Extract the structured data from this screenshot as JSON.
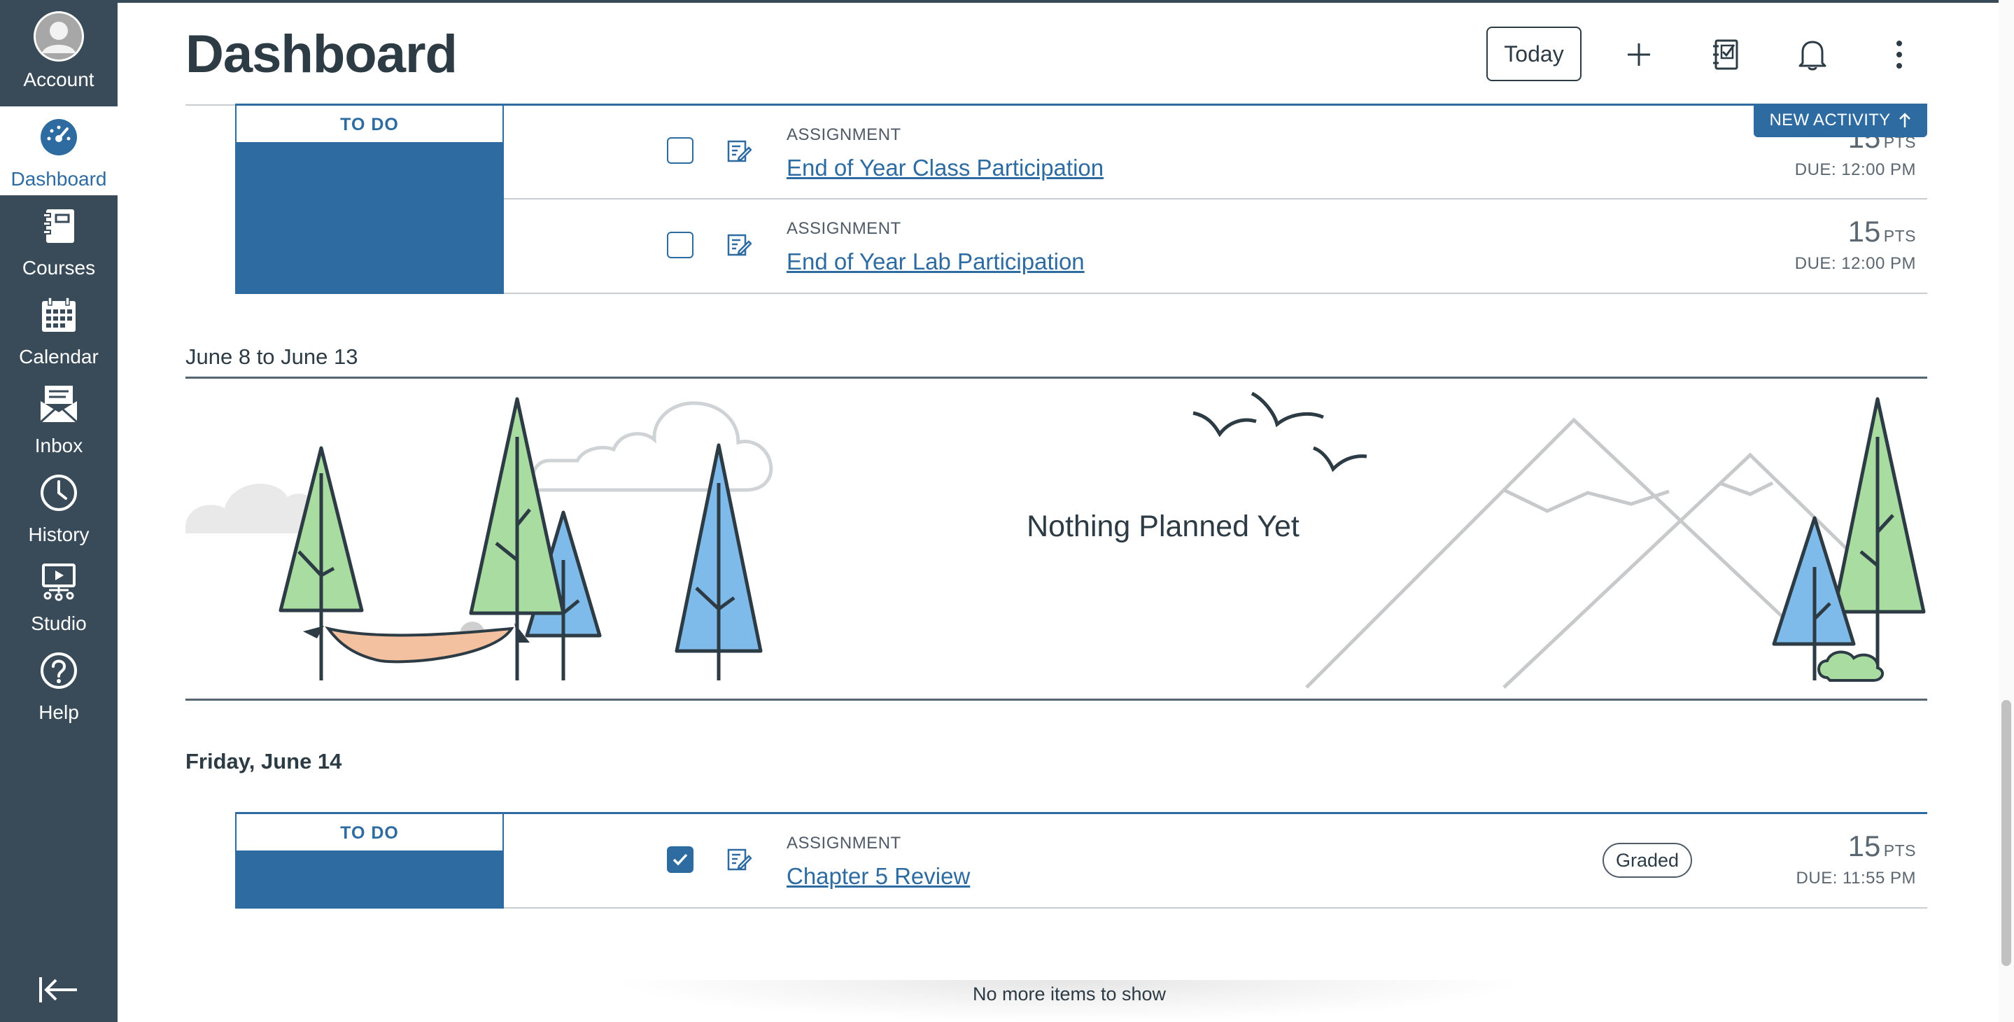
{
  "nav": {
    "items": [
      {
        "label": "Account",
        "icon": "account-avatar-icon"
      },
      {
        "label": "Dashboard",
        "icon": "dashboard-gauge-icon"
      },
      {
        "label": "Courses",
        "icon": "courses-book-icon"
      },
      {
        "label": "Calendar",
        "icon": "calendar-icon"
      },
      {
        "label": "Inbox",
        "icon": "inbox-envelope-icon"
      },
      {
        "label": "History",
        "icon": "history-clock-icon"
      },
      {
        "label": "Studio",
        "icon": "studio-monitor-icon"
      },
      {
        "label": "Help",
        "icon": "help-question-icon"
      }
    ],
    "active": "Dashboard"
  },
  "header": {
    "title": "Dashboard",
    "today_label": "Today"
  },
  "new_activity_label": "NEW ACTIVITY",
  "groups": [
    {
      "todo_label": "TO DO",
      "items": [
        {
          "type": "ASSIGNMENT",
          "title": "End of Year Class Participation",
          "points": "15",
          "points_unit": "PTS",
          "due": "DUE: 12:00 PM",
          "checked": false
        },
        {
          "type": "ASSIGNMENT",
          "title": "End of Year Lab Participation",
          "points": "15",
          "points_unit": "PTS",
          "due": "DUE: 12:00 PM",
          "checked": false
        }
      ]
    },
    {
      "todo_label": "TO DO",
      "items": [
        {
          "type": "ASSIGNMENT",
          "title": "Chapter 5 Review",
          "status": "Graded",
          "points": "15",
          "points_unit": "PTS",
          "due": "DUE: 11:55 PM",
          "checked": true
        }
      ]
    }
  ],
  "empty_range": {
    "heading": "June 8 to June 13",
    "message": "Nothing Planned Yet"
  },
  "day_heading": "Friday, June 14",
  "footer_message": "No more items to show",
  "colors": {
    "nav_bg": "#394b58",
    "brand_blue": "#2d6ba1",
    "text": "#2d3b45",
    "tree_green": "#a8dca0",
    "tree_blue": "#7fbbea",
    "hammock": "#f3c0a0"
  }
}
